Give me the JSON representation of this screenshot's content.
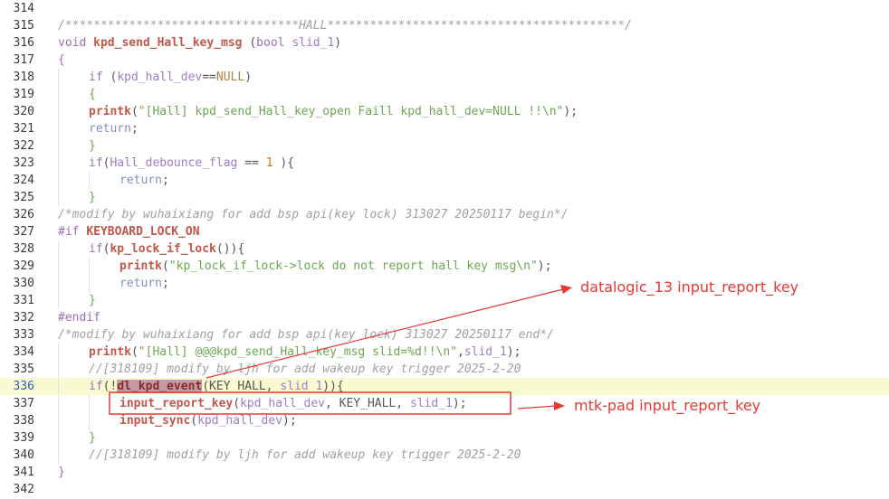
{
  "lines": [
    {
      "n": "314",
      "indent": 0,
      "tokens": []
    },
    {
      "n": "315",
      "indent": 0,
      "tokens": [
        {
          "c": "t-com",
          "t": "/*********************************HALL******************************************/"
        }
      ]
    },
    {
      "n": "316",
      "indent": 0,
      "tokens": [
        {
          "c": "t-kw",
          "t": "void "
        },
        {
          "c": "t-fn",
          "t": "kpd_send_Hall_key_msg"
        },
        {
          "c": "t-txt",
          "t": " "
        },
        {
          "c": "t-op",
          "t": "("
        },
        {
          "c": "t-kw",
          "t": "bool "
        },
        {
          "c": "t-var",
          "t": "slid_1"
        },
        {
          "c": "t-op",
          "t": ")"
        }
      ]
    },
    {
      "n": "317",
      "indent": 0,
      "tokens": [
        {
          "c": "t-kw",
          "t": "{"
        }
      ]
    },
    {
      "n": "318",
      "indent": 1,
      "tokens": [
        {
          "c": "t-kw",
          "t": "if "
        },
        {
          "c": "t-op",
          "t": "("
        },
        {
          "c": "t-var",
          "t": "kpd_hall_dev"
        },
        {
          "c": "t-op",
          "t": "=="
        },
        {
          "c": "t-null",
          "t": "NULL"
        },
        {
          "c": "t-op",
          "t": ")"
        }
      ]
    },
    {
      "n": "319",
      "indent": 1,
      "tokens": [
        {
          "c": "t-str",
          "t": "{"
        }
      ]
    },
    {
      "n": "320",
      "indent": 1,
      "tokens": [
        {
          "c": "t-fn",
          "t": "printk"
        },
        {
          "c": "t-op",
          "t": "("
        },
        {
          "c": "t-str",
          "t": "\"[Hall] kpd_send_Hall_key_open Faill kpd_hall_dev=NULL !!\\n\""
        },
        {
          "c": "t-op",
          "t": ");"
        }
      ]
    },
    {
      "n": "321",
      "indent": 1,
      "tokens": [
        {
          "c": "t-ret",
          "t": "return"
        },
        {
          "c": "t-op",
          "t": ";"
        }
      ]
    },
    {
      "n": "322",
      "indent": 1,
      "tokens": [
        {
          "c": "t-str",
          "t": "}"
        }
      ]
    },
    {
      "n": "323",
      "indent": 1,
      "tokens": [
        {
          "c": "t-kw",
          "t": "if"
        },
        {
          "c": "t-op",
          "t": "("
        },
        {
          "c": "t-var",
          "t": "Hall_debounce_flag"
        },
        {
          "c": "t-op",
          "t": " == "
        },
        {
          "c": "t-num",
          "t": "1"
        },
        {
          "c": "t-op",
          "t": " ){"
        }
      ]
    },
    {
      "n": "324",
      "indent": 2,
      "tokens": [
        {
          "c": "t-ret",
          "t": "return"
        },
        {
          "c": "t-op",
          "t": ";"
        }
      ]
    },
    {
      "n": "325",
      "indent": 1,
      "tokens": [
        {
          "c": "t-str",
          "t": "}"
        }
      ]
    },
    {
      "n": "326",
      "indent": 0,
      "tokens": [
        {
          "c": "t-com",
          "t": "/*modify by wuhaixiang for add bsp api(key lock) 313027 20250117 begin*/"
        }
      ]
    },
    {
      "n": "327",
      "indent": 0,
      "tokens": [
        {
          "c": "t-kw",
          "t": "#if "
        },
        {
          "c": "t-pre",
          "t": "KEYBOARD_LOCK_ON"
        }
      ]
    },
    {
      "n": "328",
      "indent": 1,
      "tokens": [
        {
          "c": "t-kw",
          "t": "if"
        },
        {
          "c": "t-op",
          "t": "("
        },
        {
          "c": "t-fn",
          "t": "kp_lock_if_lock"
        },
        {
          "c": "t-op",
          "t": "()){"
        }
      ]
    },
    {
      "n": "329",
      "indent": 2,
      "tokens": [
        {
          "c": "t-fn",
          "t": "printk"
        },
        {
          "c": "t-op",
          "t": "("
        },
        {
          "c": "t-str",
          "t": "\"kp_lock_if_lock->lock do not report hall key msg\\n\""
        },
        {
          "c": "t-op",
          "t": ");"
        }
      ]
    },
    {
      "n": "330",
      "indent": 2,
      "tokens": [
        {
          "c": "t-ret",
          "t": "return"
        },
        {
          "c": "t-op",
          "t": ";"
        }
      ]
    },
    {
      "n": "331",
      "indent": 1,
      "tokens": [
        {
          "c": "t-str",
          "t": "}"
        }
      ]
    },
    {
      "n": "332",
      "indent": 0,
      "tokens": [
        {
          "c": "t-kw",
          "t": "#endif"
        }
      ]
    },
    {
      "n": "333",
      "indent": 0,
      "tokens": [
        {
          "c": "t-com",
          "t": "/*modify by wuhaixiang for add bsp api(key lock) 313027 20250117 end*/"
        }
      ]
    },
    {
      "n": "334",
      "indent": 1,
      "tokens": [
        {
          "c": "t-fn",
          "t": "printk"
        },
        {
          "c": "t-op",
          "t": "("
        },
        {
          "c": "t-str",
          "t": "\"[Hall] @@@kpd_send_Hall_key_msg slid=%d!!\\n\""
        },
        {
          "c": "t-op",
          "t": ","
        },
        {
          "c": "t-var",
          "t": "slid_1"
        },
        {
          "c": "t-op",
          "t": ");"
        }
      ]
    },
    {
      "n": "335",
      "indent": 1,
      "tokens": [
        {
          "c": "t-com",
          "t": "//[318109] modify by ljh for add wakeup key trigger 2025-2-20"
        }
      ]
    },
    {
      "n": "336",
      "indent": 1,
      "active": true,
      "tokens": [
        {
          "c": "t-kw",
          "t": "if"
        },
        {
          "c": "t-op",
          "t": "(!"
        },
        {
          "c": "hl-sel",
          "t": "dl_kpd_event"
        },
        {
          "c": "t-op",
          "t": "(KEY_HALL, "
        },
        {
          "c": "t-var",
          "t": "slid_1"
        },
        {
          "c": "t-op",
          "t": ")){"
        }
      ]
    },
    {
      "n": "337",
      "indent": 2,
      "tokens": [
        {
          "c": "t-fn",
          "t": "input_report_key"
        },
        {
          "c": "t-op",
          "t": "("
        },
        {
          "c": "t-var",
          "t": "kpd_hall_dev"
        },
        {
          "c": "t-op",
          "t": ", KEY_HALL, "
        },
        {
          "c": "t-var",
          "t": "slid_1"
        },
        {
          "c": "t-op",
          "t": ");"
        }
      ]
    },
    {
      "n": "338",
      "indent": 2,
      "tokens": [
        {
          "c": "t-fn",
          "t": "input_sync"
        },
        {
          "c": "t-op",
          "t": "("
        },
        {
          "c": "t-var",
          "t": "kpd_hall_dev"
        },
        {
          "c": "t-op",
          "t": ");"
        }
      ]
    },
    {
      "n": "339",
      "indent": 1,
      "tokens": [
        {
          "c": "t-str",
          "t": "}"
        }
      ]
    },
    {
      "n": "340",
      "indent": 1,
      "tokens": [
        {
          "c": "t-com",
          "t": "//[318109] modify by ljh for add wakeup key trigger 2025-2-20"
        }
      ]
    },
    {
      "n": "341",
      "indent": 0,
      "tokens": [
        {
          "c": "t-kw",
          "t": "}"
        }
      ]
    },
    {
      "n": "342",
      "indent": 0,
      "tokens": []
    }
  ],
  "annotations": {
    "datalogic": "datalogic_13 input_report_key",
    "mtkpad": "mtk-pad input_report_key"
  },
  "colors": {
    "annotation": "#e53935",
    "active_line": "#fafad2"
  }
}
